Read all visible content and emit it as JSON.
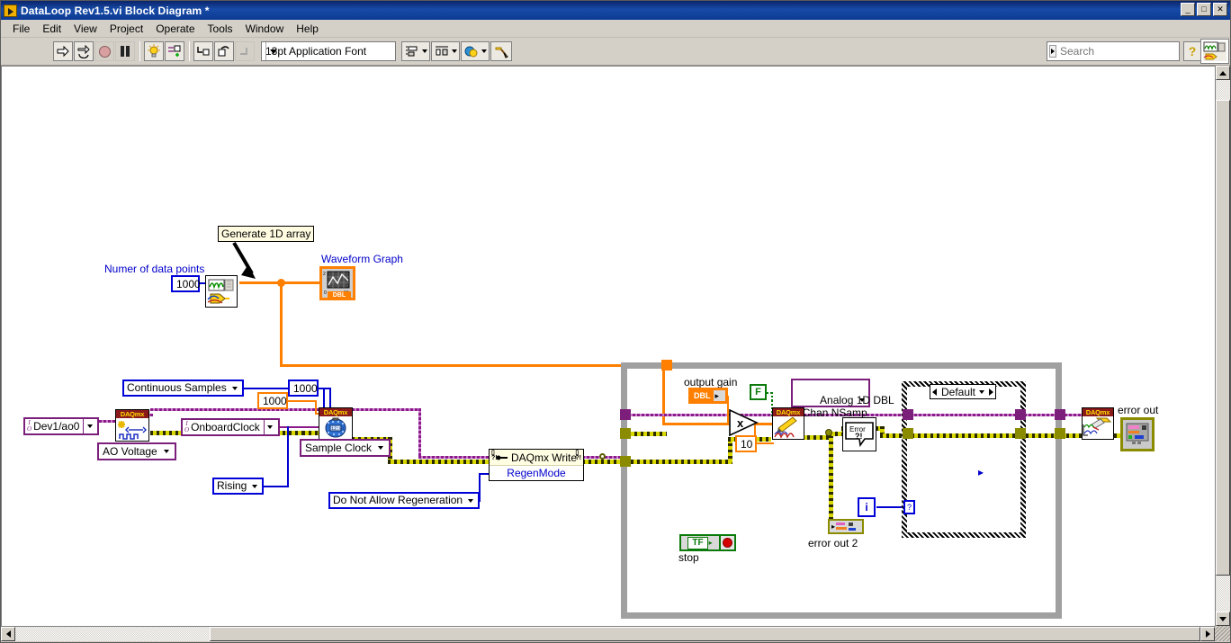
{
  "window": {
    "title": "DataLoop Rev1.5.vi Block Diagram *",
    "icon": "labview-vi-icon",
    "buttons": {
      "minimize": "_",
      "maximize": "□",
      "close": "✕"
    }
  },
  "menu": {
    "items": [
      "File",
      "Edit",
      "View",
      "Project",
      "Operate",
      "Tools",
      "Window",
      "Help"
    ]
  },
  "toolbar": {
    "font_selector": "13pt Application Font",
    "buttons": [
      {
        "name": "run-button",
        "glyph": "⇨"
      },
      {
        "name": "run-continuously-button",
        "glyph": "⇄"
      },
      {
        "name": "abort-execution-button",
        "glyph": "●"
      },
      {
        "name": "pause-button",
        "glyph": "❚❚"
      },
      {
        "name": "highlight-execution-button",
        "glyph": "💡"
      },
      {
        "name": "retain-wire-values-button",
        "glyph": "⊕"
      },
      {
        "name": "step-into-button",
        "glyph": "↳"
      },
      {
        "name": "step-over-button",
        "glyph": "⤵"
      },
      {
        "name": "step-out-button",
        "glyph": "⤴"
      }
    ],
    "combos": [
      "text-align-combo",
      "distribute-objects-combo",
      "reorder-combo",
      "clean-up-diagram-button"
    ],
    "search_placeholder": "Search",
    "help_label": "?"
  },
  "diagram": {
    "labels": {
      "num_points_label": "Numer of data points",
      "num_points_value": "1000",
      "generate_comment": "Generate 1D array",
      "waveform_graph_label": "Waveform Graph",
      "waveform_graph_type": "DBL",
      "output_gain_label": "output gain",
      "output_gain_type": "DBL",
      "error_out_label": "error out",
      "error_out2_label": "error out 2",
      "stop_label": "stop",
      "stop_const": "TF",
      "iteration_terminal": "i",
      "case_selector": "Default",
      "boolean_false_const": "F",
      "gain_const": "10"
    },
    "constants": {
      "physical_channel": "Dev1/ao0",
      "ao_voltage": "AO Voltage",
      "continuous_samples": "Continuous Samples",
      "rate_blue": "1000",
      "samples_orange": "1000",
      "onboard_clock": "OnboardClock",
      "rising": "Rising",
      "sample_clock": "Sample Clock",
      "regeneration": "Do Not Allow Regeneration",
      "poly_instance": "Analog 1D DBL\n1Chan NSamp"
    },
    "subvis": {
      "daqmx_write_title": "DAQmx Write",
      "daqmx_write_prop": "RegenMode",
      "error_handler": "Error ?!"
    },
    "colors": {
      "wire_orange": "#ff7f00",
      "wire_blue": "#0000d8",
      "wire_task_purple": "#7b1f7b",
      "wire_error_yellow": "#9b9b00",
      "loop_gray": "#a0a0a0",
      "daq_header_red": "#8b1a1a"
    }
  },
  "scrollbars": {
    "h_position": "left",
    "v_position": "top"
  }
}
